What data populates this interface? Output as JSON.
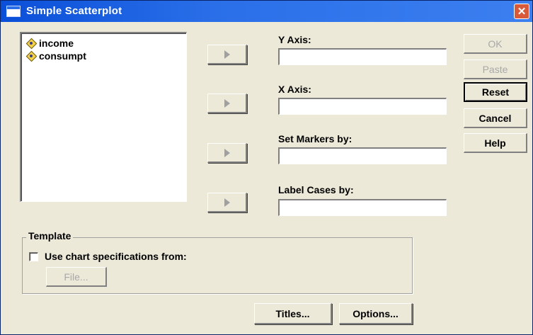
{
  "window": {
    "title": "Simple Scatterplot",
    "close_symbol": "✕"
  },
  "variables": [
    {
      "name": "income",
      "icon": "scale-variable-icon"
    },
    {
      "name": "consumpt",
      "icon": "scale-variable-icon"
    }
  ],
  "fields": {
    "y_axis": {
      "label": "Y Axis:",
      "value": ""
    },
    "x_axis": {
      "label": "X Axis:",
      "value": ""
    },
    "set_markers_by": {
      "label": "Set Markers by:",
      "value": ""
    },
    "label_cases_by": {
      "label": "Label Cases by:",
      "value": ""
    }
  },
  "buttons": {
    "ok": {
      "label": "OK",
      "enabled": false
    },
    "paste": {
      "label": "Paste",
      "enabled": false
    },
    "reset": {
      "label": "Reset",
      "enabled": true
    },
    "cancel": {
      "label": "Cancel",
      "enabled": true
    },
    "help": {
      "label": "Help",
      "enabled": true
    },
    "titles": {
      "label": "Titles..."
    },
    "options": {
      "label": "Options..."
    }
  },
  "template": {
    "group_label": "Template",
    "checkbox_label": "Use chart specifications from:",
    "checked": false,
    "file_button": "File..."
  },
  "colors": {
    "title_bar": "#2a6fe8",
    "dialog_bg": "#ece9d8",
    "disabled_text": "#a8a8a8"
  }
}
